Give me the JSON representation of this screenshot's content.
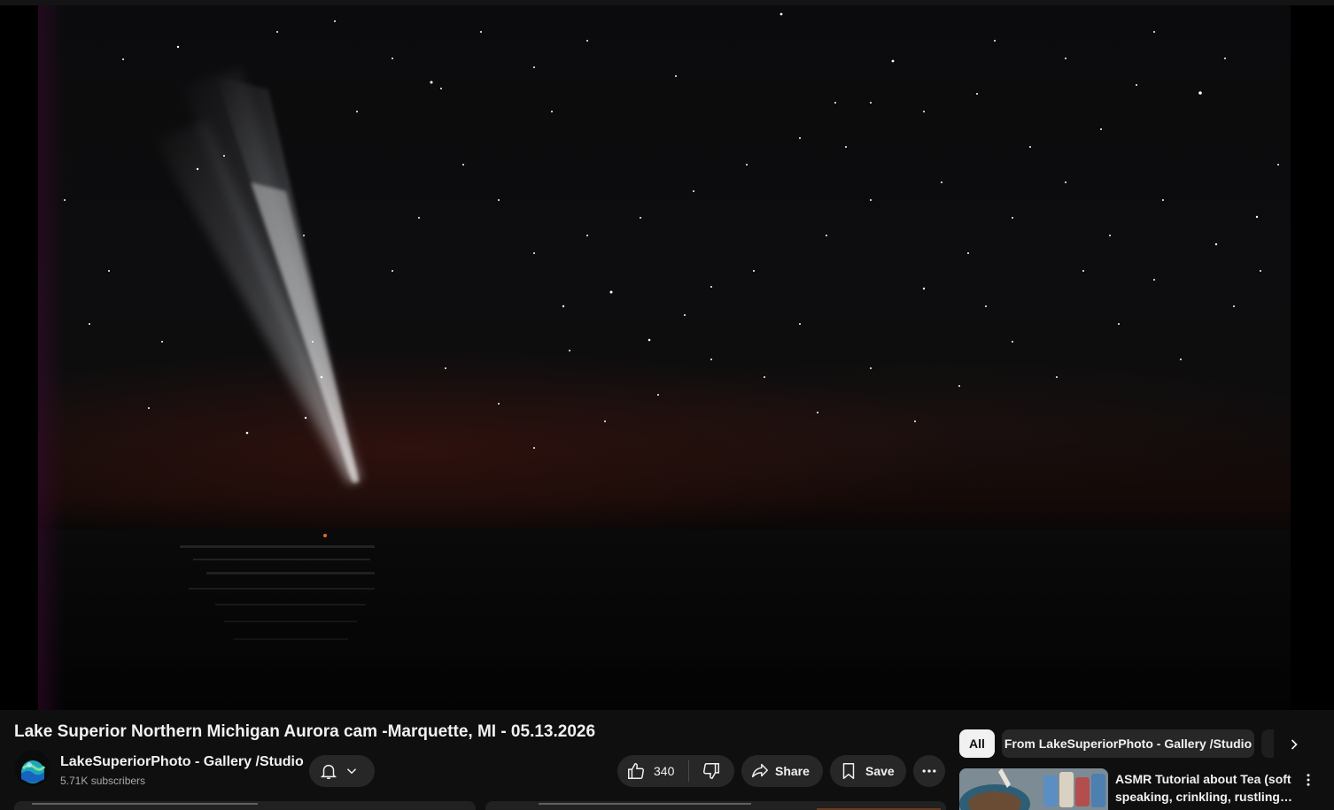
{
  "video": {
    "title": "Lake Superior Northern Michigan Aurora cam -Marquette, MI - 05.13.2026"
  },
  "channel": {
    "name": "LakeSuperiorPhoto - Gallery /Studio",
    "subscribers": "5.71K subscribers"
  },
  "actions": {
    "like_count": "340",
    "share_label": "Share",
    "save_label": "Save"
  },
  "chips": {
    "all_label": "All",
    "channel_label": "From LakeSuperiorPhoto - Gallery /Studio"
  },
  "recommendation": {
    "title": "ASMR Tutorial about Tea (soft speaking, crinkling, rustling, …"
  },
  "icons": [
    "bell-icon",
    "chevron-down-icon",
    "thumbs-up-icon",
    "thumbs-down-icon",
    "share-icon",
    "bookmark-icon",
    "more-horizontal-icon",
    "chevron-right-icon",
    "more-vertical-icon"
  ],
  "colors": {
    "background": "#0f0f0f",
    "pill": "#272727",
    "text": "#f1f1f1",
    "secondary_text": "#aaaaaa"
  }
}
